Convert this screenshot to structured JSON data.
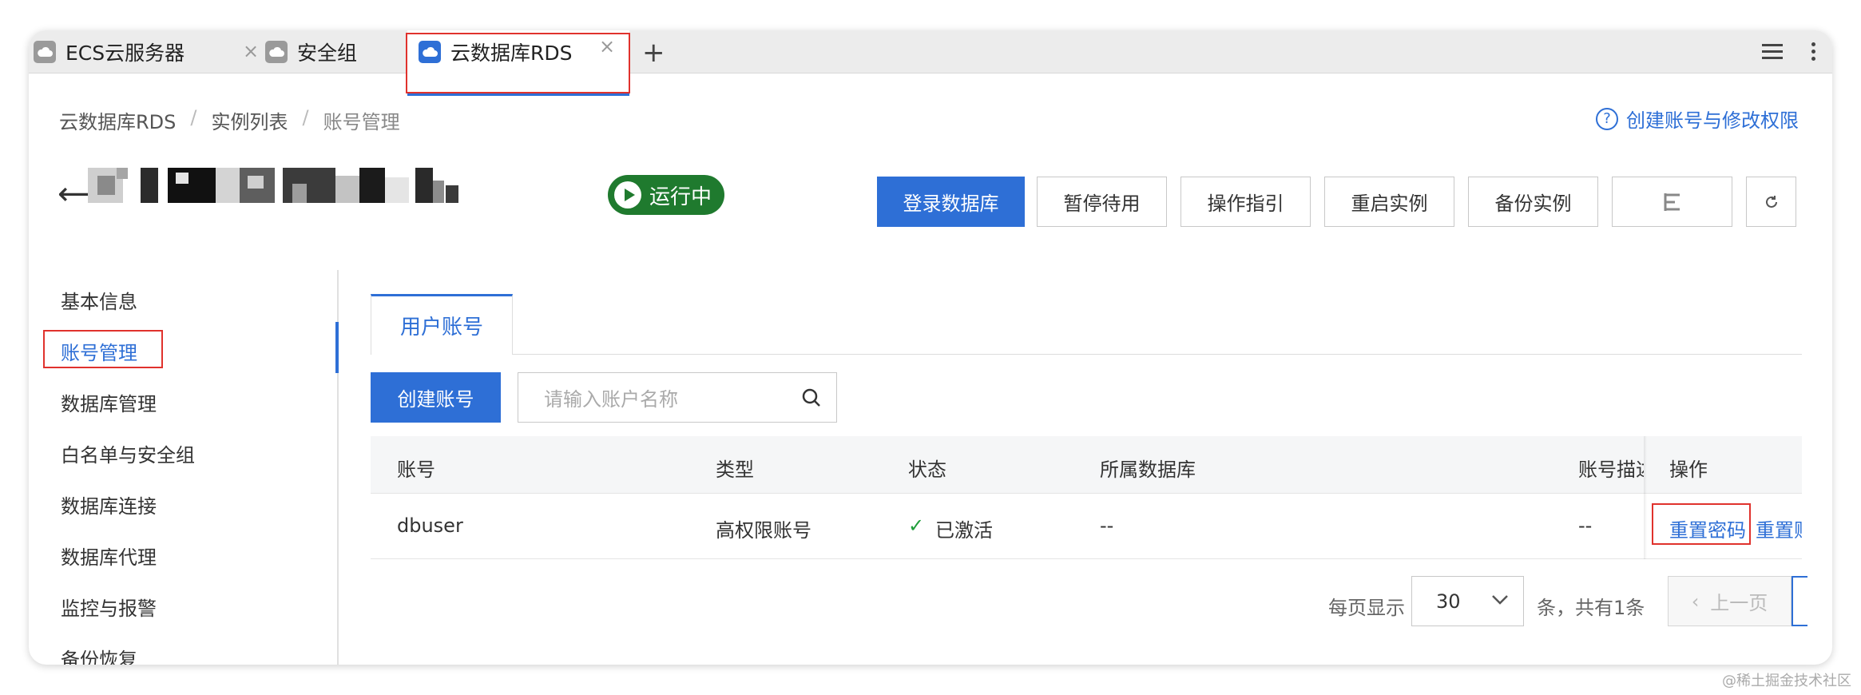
{
  "browser": {
    "tabs": [
      {
        "label": "ECS云服务器"
      },
      {
        "label": "安全组"
      },
      {
        "label": "云数据库RDS"
      }
    ]
  },
  "breadcrumb": [
    "云数据库RDS",
    "实例列表",
    "账号管理"
  ],
  "help_link": "创建账号与修改权限",
  "instance": {
    "status": "运行中"
  },
  "header_buttons": {
    "login": "登录数据库",
    "pause": "暂停待用",
    "guide": "操作指引",
    "restart": "重启实例",
    "backup": "备份实例"
  },
  "sidebar": {
    "items": [
      {
        "label": "基本信息"
      },
      {
        "label": "账号管理"
      },
      {
        "label": "数据库管理"
      },
      {
        "label": "白名单与安全组"
      },
      {
        "label": "数据库连接"
      },
      {
        "label": "数据库代理"
      },
      {
        "label": "监控与报警"
      },
      {
        "label": "备份恢复"
      }
    ]
  },
  "content": {
    "tab": "用户账号",
    "create_button": "创建账号",
    "search_placeholder": "请输入账户名称",
    "table": {
      "headers": [
        "账号",
        "类型",
        "状态",
        "所属数据库",
        "账号描述",
        "操作"
      ],
      "rows": [
        {
          "account": "dbuser",
          "type": "高权限账号",
          "status": "已激活",
          "database": "--",
          "description": "--",
          "ops": [
            "重置密码",
            "重置账"
          ]
        }
      ]
    },
    "pagination": {
      "per_page_label": "每页显示",
      "per_page_value": "30",
      "total_label": "条，共有1条",
      "prev": "上一页"
    }
  },
  "watermark": "@稀土掘金技术社区"
}
